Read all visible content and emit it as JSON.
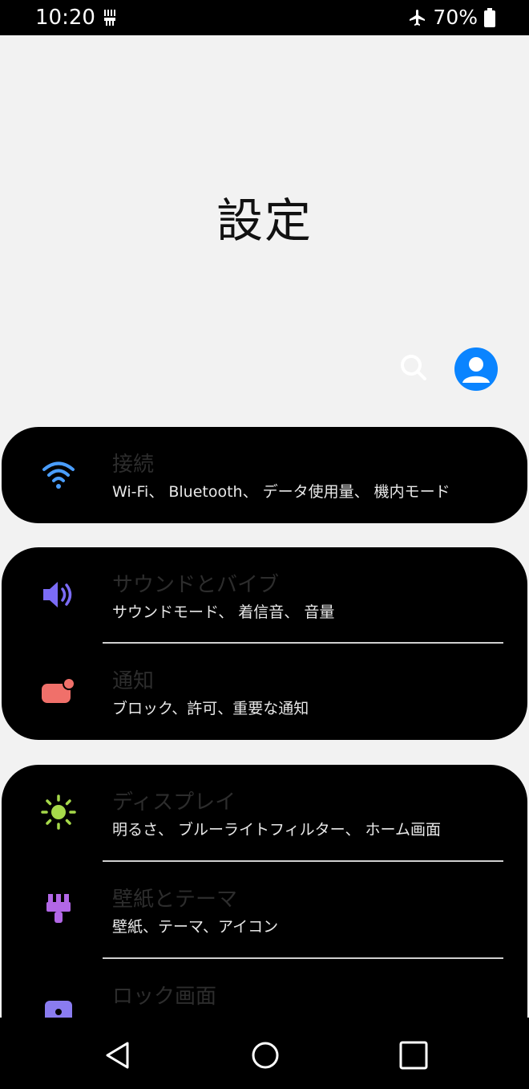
{
  "status_bar": {
    "time": "10:20",
    "battery_percent": "70%",
    "icons": [
      "usb-icon",
      "airplane-icon",
      "battery-icon"
    ]
  },
  "header": {
    "title": "設定",
    "search_icon": "search-icon",
    "profile_icon": "account-icon"
  },
  "groups": [
    {
      "items": [
        {
          "label": "接続",
          "subtitle": "Wi-Fi、 Bluetooth、 データ使用量、 機内モード",
          "icon": "wifi-icon",
          "icon_color": "#4a9eff"
        }
      ]
    },
    {
      "items": [
        {
          "label": "サウンドとバイブ",
          "subtitle": "サウンドモード、 着信音、 音量",
          "icon": "volume-icon",
          "icon_color": "#7b6cf6"
        },
        {
          "label": "通知",
          "subtitle": "ブロック、許可、重要な通知",
          "icon": "notification-icon",
          "icon_color": "#f0706a"
        }
      ]
    },
    {
      "items": [
        {
          "label": "ディスプレイ",
          "subtitle": "明るさ、 ブルーライトフィルター、 ホーム画面",
          "icon": "brightness-icon",
          "icon_color": "#a6d94a"
        },
        {
          "label": "壁紙とテーマ",
          "subtitle": "壁紙、テーマ、アイコン",
          "icon": "paintbrush-icon",
          "icon_color": "#b267e6"
        },
        {
          "label": "ロック画面",
          "subtitle": "",
          "icon": "lock-icon",
          "icon_color": "#8a7cf0"
        }
      ]
    }
  ],
  "nav_bar": {
    "back_icon": "back-icon",
    "home_icon": "home-icon",
    "recents_icon": "recents-icon"
  }
}
